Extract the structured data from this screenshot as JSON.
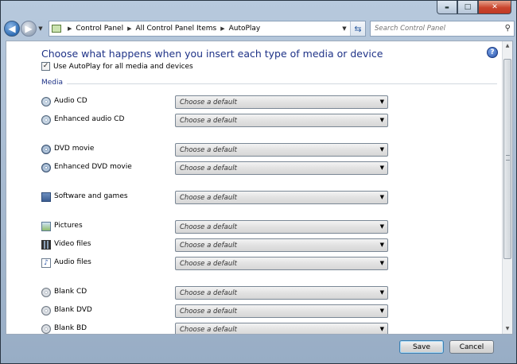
{
  "window": {
    "caption": {
      "minimize": "▬",
      "maximize": "□",
      "close": "✕"
    }
  },
  "nav": {
    "breadcrumbs": [
      "Control Panel",
      "All Control Panel Items",
      "AutoPlay"
    ],
    "search_placeholder": "Search Control Panel"
  },
  "page": {
    "title": "Choose what happens when you insert each type of media or device",
    "autoplay_checkbox": {
      "label": "Use AutoPlay for all media and devices",
      "checked": true
    },
    "section_label": "Media",
    "items": [
      {
        "label": "Audio CD",
        "value": "Choose a default",
        "icon": "audio-cd-icon"
      },
      {
        "label": "Enhanced audio CD",
        "value": "Choose a default",
        "icon": "enhanced-audio-cd-icon"
      },
      {
        "label": "DVD movie",
        "value": "Choose a default",
        "icon": "dvd-movie-icon"
      },
      {
        "label": "Enhanced DVD movie",
        "value": "Choose a default",
        "icon": "enhanced-dvd-icon"
      },
      {
        "label": "Software and games",
        "value": "Choose a default",
        "icon": "software-icon"
      },
      {
        "label": "Pictures",
        "value": "Choose a default",
        "icon": "pictures-icon"
      },
      {
        "label": "Video files",
        "value": "Choose a default",
        "icon": "video-files-icon"
      },
      {
        "label": "Audio files",
        "value": "Choose a default",
        "icon": "audio-files-icon"
      },
      {
        "label": "Blank CD",
        "value": "Choose a default",
        "icon": "blank-cd-icon"
      },
      {
        "label": "Blank DVD",
        "value": "Choose a default",
        "icon": "blank-dvd-icon"
      },
      {
        "label": "Blank BD",
        "value": "Choose a default",
        "icon": "blank-bd-icon"
      }
    ]
  },
  "buttons": {
    "save": "Save",
    "cancel": "Cancel"
  }
}
